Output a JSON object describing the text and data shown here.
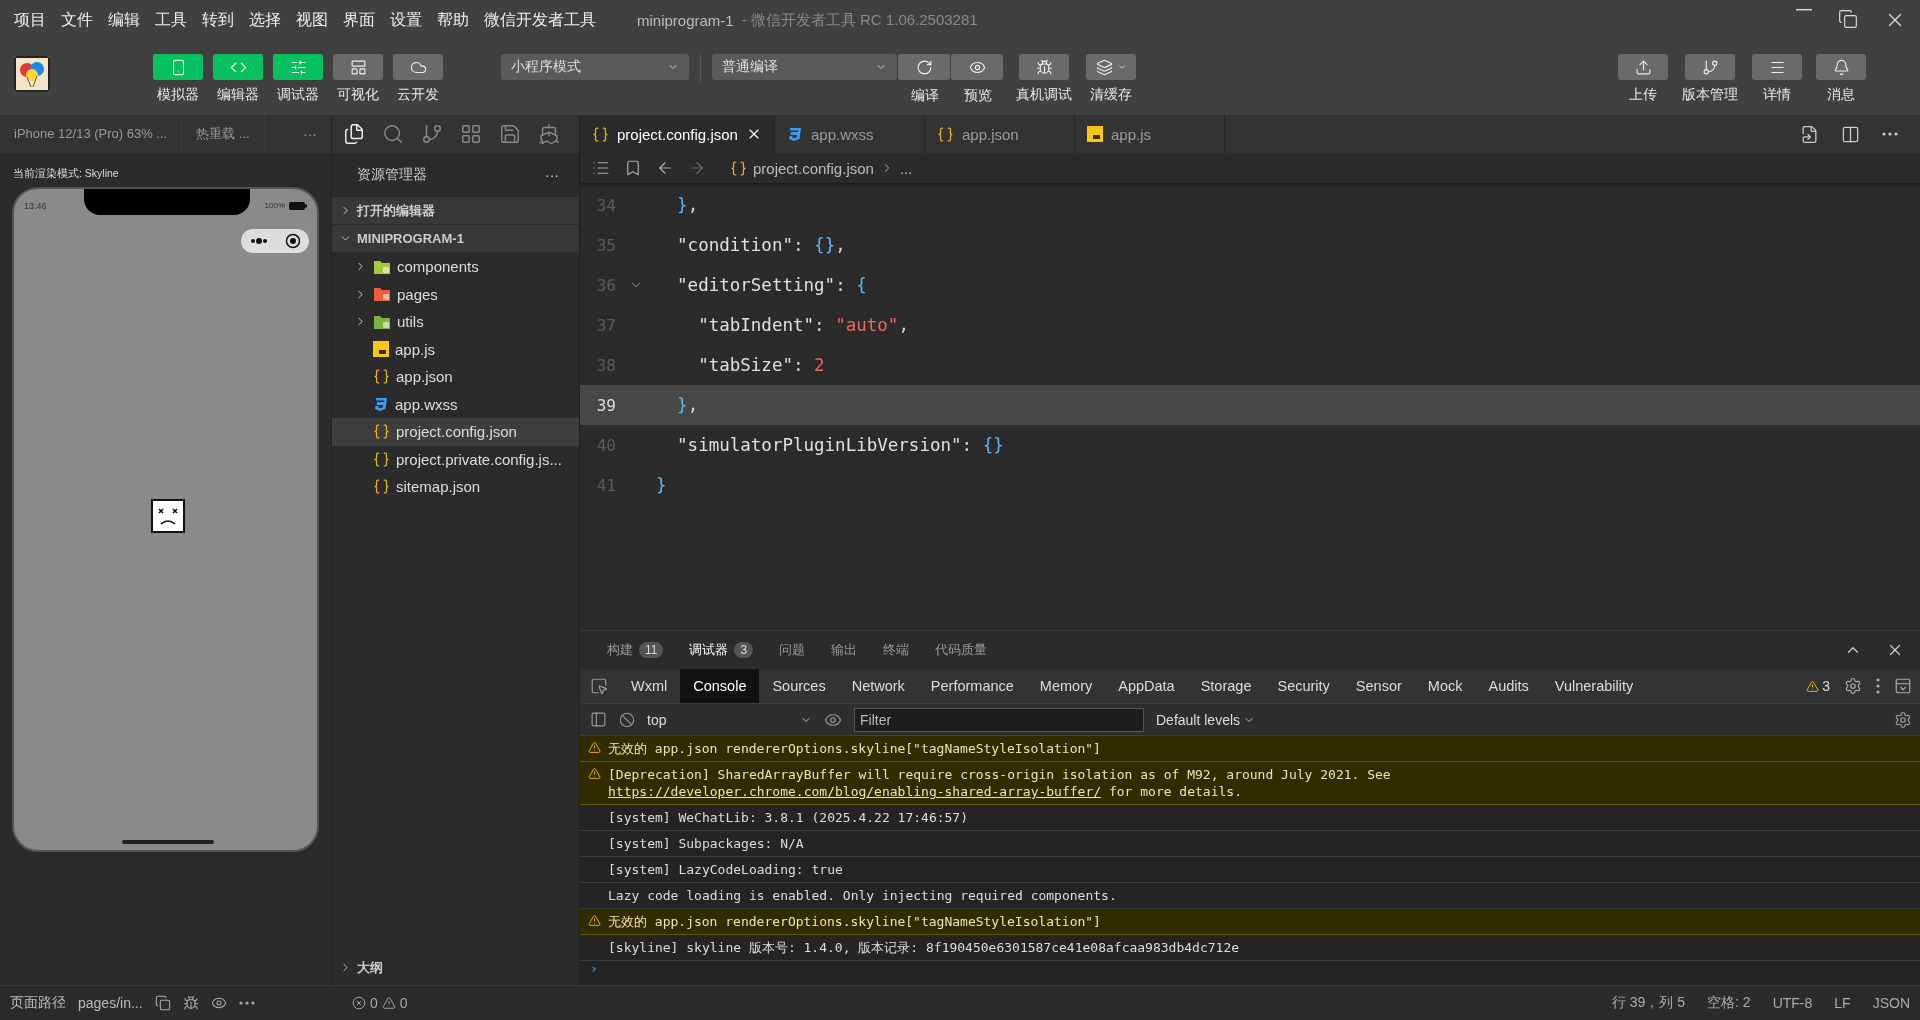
{
  "menu": {
    "items": [
      "项目",
      "文件",
      "编辑",
      "工具",
      "转到",
      "选择",
      "视图",
      "界面",
      "设置",
      "帮助",
      "微信开发者工具"
    ],
    "title": "miniprogram-1",
    "subtitle": "- 微信开发者工具 RC 1.06.2503281"
  },
  "toolbar": {
    "views": [
      {
        "label": "模拟器",
        "on": true
      },
      {
        "label": "编辑器",
        "on": true
      },
      {
        "label": "调试器",
        "on": true
      },
      {
        "label": "可视化",
        "on": false
      },
      {
        "label": "云开发",
        "on": false
      }
    ],
    "mode": "小程序模式",
    "compile": "普通编译",
    "actions": [
      "编译",
      "预览"
    ],
    "tools": [
      "真机调试",
      "清缓存"
    ],
    "right": [
      "上传",
      "版本管理",
      "详情",
      "消息"
    ]
  },
  "simulator": {
    "device": "iPhone 12/13 (Pro) 63% ...",
    "hot_reload": "热重载 ...",
    "more": "···",
    "render_mode": "当前渲染模式: Skyline",
    "time": "13:46",
    "battery": "100%",
    "page_path": "页面路径",
    "page": "pages/in..."
  },
  "explorer": {
    "title": "资源管理器",
    "more": "···",
    "sections": [
      {
        "label": "打开的编辑器",
        "expanded": false
      },
      {
        "label": "MINIPROGRAM-1",
        "expanded": true,
        "children": [
          {
            "name": "components",
            "kind": "folder",
            "color": "#a5c83c",
            "expanded": false,
            "selected": false
          },
          {
            "name": "pages",
            "kind": "folder",
            "color": "#e8613c",
            "expanded": false,
            "selected": false
          },
          {
            "name": "utils",
            "kind": "folder",
            "color": "#7cb342",
            "expanded": false,
            "selected": false
          },
          {
            "name": "app.js",
            "kind": "js",
            "selected": false
          },
          {
            "name": "app.json",
            "kind": "json",
            "selected": false
          },
          {
            "name": "app.wxss",
            "kind": "css",
            "selected": false
          },
          {
            "name": "project.config.json",
            "kind": "json",
            "selected": true
          },
          {
            "name": "project.private.config.js...",
            "kind": "json",
            "selected": false
          },
          {
            "name": "sitemap.json",
            "kind": "json",
            "selected": false
          }
        ]
      }
    ],
    "outline": {
      "label": "大纲",
      "expanded": false
    },
    "errors": "0",
    "warnings": "0"
  },
  "editor": {
    "tabs": [
      {
        "name": "project.config.json",
        "kind": "json",
        "selected": true
      },
      {
        "name": "app.wxss",
        "kind": "css",
        "selected": false
      },
      {
        "name": "app.json",
        "kind": "json",
        "selected": false
      },
      {
        "name": "app.js",
        "kind": "js",
        "selected": false
      }
    ],
    "breadcrumb": [
      "project.config.json",
      "..."
    ],
    "lines": [
      {
        "number": "34",
        "current": false,
        "fold": false,
        "text": "  },"
      },
      {
        "number": "35",
        "current": false,
        "fold": false,
        "text": "  \"condition\": {},"
      },
      {
        "number": "36",
        "current": false,
        "fold": true,
        "text": "  \"editorSetting\": {"
      },
      {
        "number": "37",
        "current": false,
        "fold": false,
        "text": "    \"tabIndent\": \"auto\","
      },
      {
        "number": "38",
        "current": false,
        "fold": false,
        "text": "    \"tabSize\": 2"
      },
      {
        "number": "39",
        "current": true,
        "fold": false,
        "text": "  },"
      },
      {
        "number": "40",
        "current": false,
        "fold": false,
        "text": "  \"simulatorPluginLibVersion\": {}"
      },
      {
        "number": "41",
        "current": false,
        "fold": false,
        "text": "}"
      }
    ],
    "status": [
      "行 39，列 5",
      "空格: 2",
      "UTF-8",
      "LF",
      "JSON"
    ]
  },
  "devtools": {
    "panels": [
      {
        "label": "构建",
        "count": "11",
        "selected": false
      },
      {
        "label": "调试器",
        "count": "3",
        "selected": true
      },
      {
        "label": "问题",
        "selected": false
      },
      {
        "label": "输出",
        "selected": false
      },
      {
        "label": "终端",
        "selected": false
      },
      {
        "label": "代码质量",
        "selected": false
      }
    ],
    "tabs": [
      {
        "label": "Wxml",
        "selected": false
      },
      {
        "label": "Console",
        "selected": true
      },
      {
        "label": "Sources",
        "selected": false
      },
      {
        "label": "Network",
        "selected": false
      },
      {
        "label": "Performance",
        "selected": false
      },
      {
        "label": "Memory",
        "selected": false
      },
      {
        "label": "AppData",
        "selected": false
      },
      {
        "label": "Storage",
        "selected": false
      },
      {
        "label": "Security",
        "selected": false
      },
      {
        "label": "Sensor",
        "selected": false
      },
      {
        "label": "Mock",
        "selected": false
      },
      {
        "label": "Audits",
        "selected": false
      },
      {
        "label": "Vulnerability",
        "selected": false
      }
    ],
    "warning_count": "3",
    "prompt": "›",
    "context": "top",
    "filter_placeholder": "Filter",
    "levels": "Default levels",
    "messages": [
      {
        "warning": true,
        "text": "无效的 app.json rendererOptions.skyline[\"tagNameStyleIsolation\"]"
      },
      {
        "warning": true,
        "text": "[Deprecation] SharedArrayBuffer will require cross-origin isolation as of M92, around July 2021. See ",
        "link": "https://developer.chrome.com/blog/enabling-shared-array-buffer/",
        "after": " for more details."
      },
      {
        "warning": false,
        "text": "[system] WeChatLib: 3.8.1 (2025.4.22 17:46:57)"
      },
      {
        "warning": false,
        "text": "[system] Subpackages: N/A"
      },
      {
        "warning": false,
        "text": "[system] LazyCodeLoading: true"
      },
      {
        "warning": false,
        "text": "Lazy code loading is enabled. Only injecting required components."
      },
      {
        "warning": true,
        "text": "无效的 app.json rendererOptions.skyline[\"tagNameStyleIsolation\"]"
      },
      {
        "warning": false,
        "text": "[skyline] skyline 版本号: 1.4.0, 版本记录: 8f190450e6301587ce41e08afcaa983db4dc712e"
      }
    ]
  }
}
